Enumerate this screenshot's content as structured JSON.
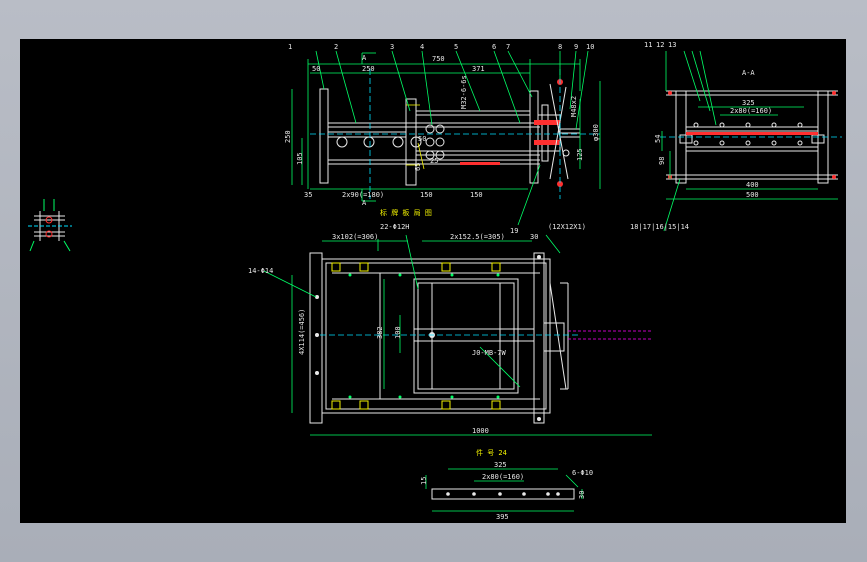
{
  "drawing": {
    "balloon_labels_main": [
      "1",
      "2",
      "3",
      "4",
      "5",
      "6",
      "7",
      "8",
      "9",
      "10"
    ],
    "balloon_labels_section": [
      "11",
      "12",
      "13"
    ],
    "section_title": "A-A",
    "section_marker": "A",
    "dims_main_top": [
      "750",
      "250",
      "371",
      "50"
    ],
    "dims_main_left": [
      "250",
      "105"
    ],
    "dims_main_bottom": [
      "35",
      "2x90(=180)",
      "150",
      "150"
    ],
    "dims_main_misc": [
      "M32-6-6s",
      "M48x2",
      "125",
      "φ300",
      "50",
      "25",
      "65"
    ],
    "dims_section": [
      "325",
      "2x80(=160)",
      "54",
      "98",
      "400",
      "500"
    ],
    "section_labels_lower": "18|17|16|15|14",
    "callout_19": "19",
    "stamp_text": "标 牌 板 局 图",
    "plan_dims_top": [
      "3x102(=306)",
      "2x152.5(=305)",
      "30"
    ],
    "plan_note_top": "22-Φ12H",
    "plan_note_side": "(12X12X1)",
    "plan_hole_note": "14-Φ14",
    "plan_left_dim": "4X114(=456)",
    "plan_inner_dims": [
      "382",
      "100"
    ],
    "plan_label_center": "J0-MB-7W",
    "plan_bottom_dim": "1000",
    "bar_title": "件 号 24",
    "bar_dims": [
      "325",
      "2x80(=160)",
      "395",
      "15",
      "30"
    ],
    "bar_hole_note": "6-Φ10"
  }
}
